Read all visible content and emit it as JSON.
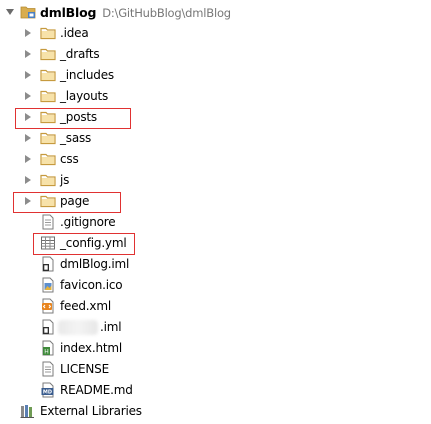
{
  "root": {
    "label": "dmlBlog",
    "path": "D:\\GitHubBlog\\dmlBlog",
    "expanded": true
  },
  "folders": [
    {
      "label": ".idea",
      "highlighted": false
    },
    {
      "label": "_drafts",
      "highlighted": false
    },
    {
      "label": "_includes",
      "highlighted": false
    },
    {
      "label": "_layouts",
      "highlighted": false
    },
    {
      "label": "_posts",
      "highlighted": true
    },
    {
      "label": "_sass",
      "highlighted": false
    },
    {
      "label": "css",
      "highlighted": false
    },
    {
      "label": "js",
      "highlighted": false
    },
    {
      "label": "page",
      "highlighted": true
    }
  ],
  "files": [
    {
      "label": ".gitignore",
      "icon": "text-file-icon",
      "highlighted": false
    },
    {
      "label": "_config.yml",
      "icon": "yml-file-icon",
      "highlighted": true
    },
    {
      "label": "dmlBlog.iml",
      "icon": "iml-file-icon",
      "highlighted": false
    },
    {
      "label": "favicon.ico",
      "icon": "image-file-icon",
      "highlighted": false
    },
    {
      "label": "feed.xml",
      "icon": "xml-file-icon",
      "highlighted": false
    },
    {
      "label": ".iml",
      "icon": "iml-file-icon",
      "highlighted": false,
      "name_obscured": true
    },
    {
      "label": "index.html",
      "icon": "html-file-icon",
      "highlighted": false
    },
    {
      "label": "LICENSE",
      "icon": "text-file-icon",
      "highlighted": false
    },
    {
      "label": "README.md",
      "icon": "markdown-file-icon",
      "highlighted": false
    }
  ],
  "external": {
    "label": "External Libraries",
    "icon": "libraries-icon"
  },
  "colors": {
    "folder": "#d8ad4f",
    "highlight_border": "#e03232",
    "path_text": "#777777"
  }
}
